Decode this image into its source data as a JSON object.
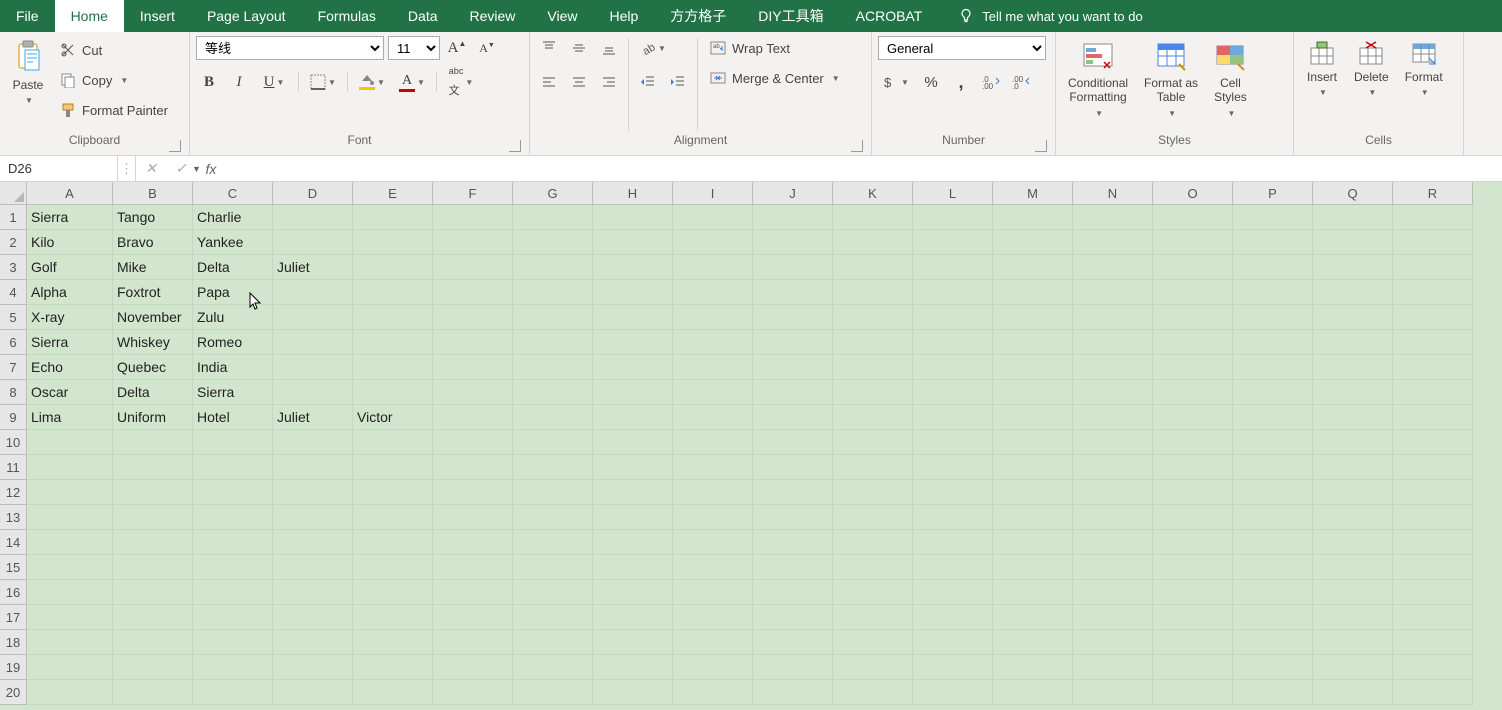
{
  "menu": {
    "tabs": [
      "File",
      "Home",
      "Insert",
      "Page Layout",
      "Formulas",
      "Data",
      "Review",
      "View",
      "Help",
      "方方格子",
      "DIY工具箱",
      "ACROBAT"
    ],
    "active": 1,
    "tell": "Tell me what you want to do"
  },
  "ribbon": {
    "clipboard": {
      "label": "Clipboard",
      "paste": "Paste",
      "cut": "Cut",
      "copy": "Copy",
      "format_painter": "Format Painter"
    },
    "font": {
      "label": "Font",
      "name": "等线",
      "size": "11"
    },
    "alignment": {
      "label": "Alignment",
      "wrap": "Wrap Text",
      "merge": "Merge & Center"
    },
    "number": {
      "label": "Number",
      "format": "General"
    },
    "styles": {
      "label": "Styles",
      "cond": "Conditional\nFormatting",
      "table": "Format as\nTable",
      "cell": "Cell\nStyles"
    },
    "cells": {
      "label": "Cells",
      "insert": "Insert",
      "delete": "Delete",
      "format": "Format"
    }
  },
  "fxbar": {
    "namebox": "D26",
    "formula": ""
  },
  "grid": {
    "columns": [
      "A",
      "B",
      "C",
      "D",
      "E",
      "F",
      "G",
      "H",
      "I",
      "J",
      "K",
      "L",
      "M",
      "N",
      "O",
      "P",
      "Q",
      "R"
    ],
    "visible_rows": 20,
    "data": [
      [
        "Sierra",
        "Tango",
        "Charlie",
        "",
        ""
      ],
      [
        "Kilo",
        "Bravo",
        "Yankee",
        "",
        ""
      ],
      [
        "Golf",
        "Mike",
        "Delta",
        "Juliet",
        ""
      ],
      [
        "Alpha",
        "Foxtrot",
        "Papa",
        "",
        ""
      ],
      [
        "X-ray",
        "November",
        "Zulu",
        "",
        ""
      ],
      [
        "Sierra",
        "Whiskey",
        "Romeo",
        "",
        ""
      ],
      [
        "Echo",
        "Quebec",
        "India",
        "",
        ""
      ],
      [
        "Oscar",
        "Delta",
        "Sierra",
        "",
        ""
      ],
      [
        "Lima",
        "Uniform",
        "Hotel",
        "Juliet",
        "Victor"
      ]
    ],
    "cursor_pos": {
      "row": 3.6,
      "col": 2.7
    }
  }
}
